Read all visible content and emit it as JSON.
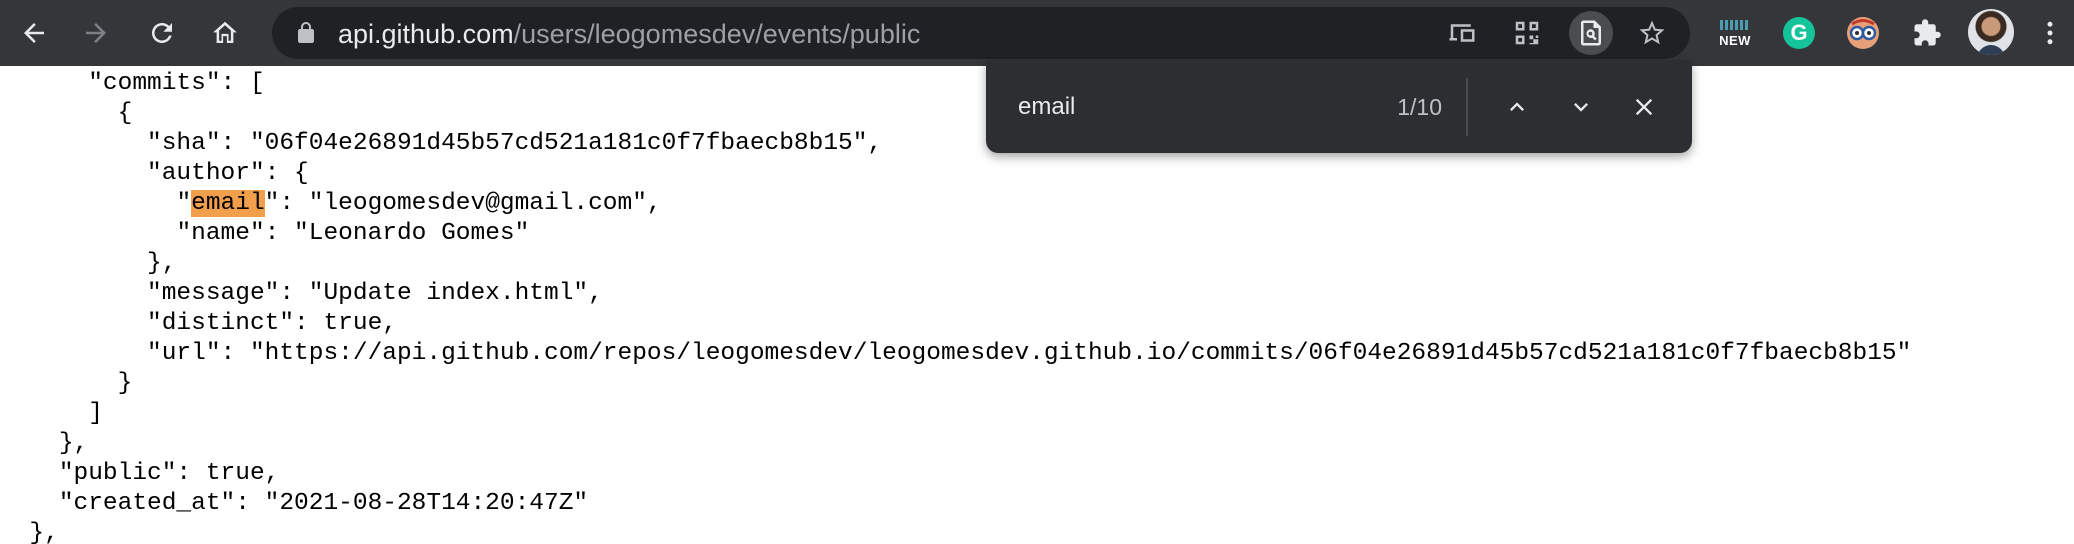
{
  "browser": {
    "url_host": "api.github.com",
    "url_path": "/users/leogomesdev/events/public",
    "icons": {
      "back": "arrow-left-icon",
      "forward": "arrow-right-icon",
      "reload": "reload-icon",
      "home": "home-icon",
      "lock": "lock-icon",
      "cast": "cast-icon",
      "qr": "qr-code-icon",
      "find": "find-in-page-icon",
      "bookmark": "star-icon",
      "extensions": "puzzle-icon",
      "menu": "kebab-menu-icon"
    },
    "extensions": {
      "new_badge_label": "NEW",
      "grammarly_label": "G"
    }
  },
  "find_bar": {
    "query": "email",
    "match_count": "1/10"
  },
  "json_view": {
    "lines": [
      {
        "indent": "      ",
        "text": "\"commits\": ["
      },
      {
        "indent": "        ",
        "text": "{"
      },
      {
        "indent": "          ",
        "text": "\"sha\": \"06f04e26891d45b57cd521a181c0f7fbaecb8b15\","
      },
      {
        "indent": "          ",
        "text": "\"author\": {"
      },
      {
        "indent": "            ",
        "pre": "\"",
        "highlight": "email",
        "post": "\": \"leogomesdev@gmail.com\","
      },
      {
        "indent": "            ",
        "text": "\"name\": \"Leonardo Gomes\""
      },
      {
        "indent": "          ",
        "text": "},"
      },
      {
        "indent": "          ",
        "text": "\"message\": \"Update index.html\","
      },
      {
        "indent": "          ",
        "text": "\"distinct\": true,"
      },
      {
        "indent": "          ",
        "text": "\"url\": \"https://api.github.com/repos/leogomesdev/leogomesdev.github.io/commits/06f04e26891d45b57cd521a181c0f7fbaecb8b15\""
      },
      {
        "indent": "        ",
        "text": "}"
      },
      {
        "indent": "      ",
        "text": "]"
      },
      {
        "indent": "    ",
        "text": "},"
      },
      {
        "indent": "    ",
        "text": "\"public\": true,"
      },
      {
        "indent": "    ",
        "text": "\"created_at\": \"2021-08-28T14:20:47Z\""
      },
      {
        "indent": "  ",
        "text": "},"
      }
    ]
  }
}
